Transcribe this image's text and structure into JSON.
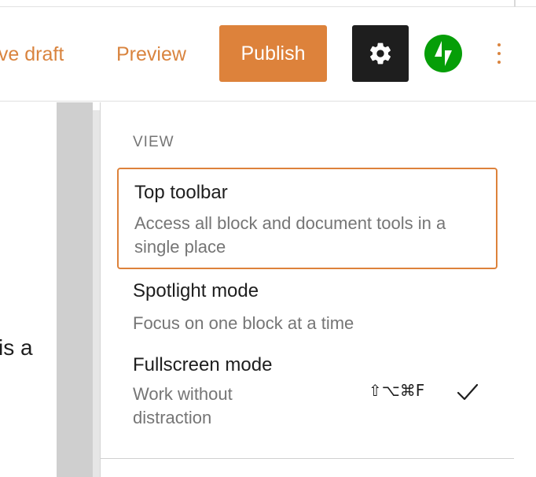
{
  "header": {
    "save_draft": "ave draft",
    "preview": "Preview",
    "publish": "Publish",
    "icons": {
      "settings": "gear-icon",
      "jetpack": "jetpack-icon",
      "more": "vertical-ellipsis-icon"
    }
  },
  "editor": {
    "visible_text": "is a"
  },
  "menu": {
    "group_label": "VIEW",
    "items": [
      {
        "title": "Top toolbar",
        "description": "Access all block and document tools in a single place"
      },
      {
        "title": "Spotlight mode",
        "description": "Focus on one block at a time"
      },
      {
        "title": "Fullscreen mode",
        "description": "Work without distraction",
        "shortcut": "⇧⌥⌘F",
        "checked": true
      }
    ]
  },
  "colors": {
    "accent": "#dd823b",
    "link": "#d9843f",
    "settings_bg": "#1e1e1e",
    "jetpack": "#069e08",
    "muted_text": "#757575"
  }
}
